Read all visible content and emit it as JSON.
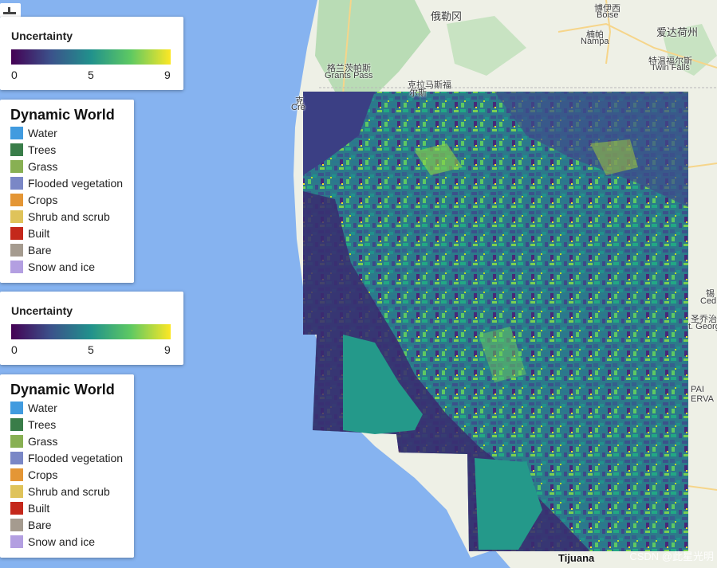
{
  "colors": {
    "ocean": "#86b3f0",
    "land": "#eef0e6",
    "forest": "#b9dcb5",
    "uncertainty_ramp": [
      "#440154",
      "#3b528b",
      "#21918c",
      "#5ec962",
      "#fde725"
    ]
  },
  "map_labels": {
    "oregon": "俄勒冈",
    "boise_cn": "博伊西",
    "boise": "Boise",
    "nampa_cn": "楠帕",
    "nampa": "Nampa",
    "idaho": "爱达荷州",
    "twin_falls_cn": "特温福尔斯",
    "twin_falls": "Twin Falls",
    "grants_pass_cn": "格兰茨帕斯",
    "grants_pass": "Grants Pass",
    "klamath_cn": "克拉马斯福",
    "klamath_partial": "尔斯",
    "crescent_cn_partial": "克",
    "crescent_partial": "Cre",
    "cedar_cn_partial": "锡",
    "cedar_partial": "Ced",
    "st_george_cn_partial": "圣乔治",
    "st_george_partial": "t. Georg",
    "kaibab_partial_1": "PAI",
    "kaibab_partial_2": "ERVA",
    "tijuana": "Tijuana"
  },
  "tool_icon": "draw-tool-icon",
  "legends": [
    {
      "type": "uncertainty",
      "title": "Uncertainty",
      "ticks": [
        "0",
        "5",
        "9"
      ]
    },
    {
      "type": "dynamic-world",
      "title": "Dynamic World",
      "items": [
        {
          "label": "Water",
          "color": "#419bdf"
        },
        {
          "label": "Trees",
          "color": "#397d49"
        },
        {
          "label": "Grass",
          "color": "#88b053"
        },
        {
          "label": "Flooded vegetation",
          "color": "#7a87c6"
        },
        {
          "label": "Crops",
          "color": "#e49635"
        },
        {
          "label": "Shrub and scrub",
          "color": "#dfc35a"
        },
        {
          "label": "Built",
          "color": "#c4281b"
        },
        {
          "label": "Bare",
          "color": "#a59b8f"
        },
        {
          "label": "Snow and ice",
          "color": "#b39fe1"
        }
      ]
    },
    {
      "type": "uncertainty",
      "title": "Uncertainty",
      "ticks": [
        "0",
        "5",
        "9"
      ]
    },
    {
      "type": "dynamic-world",
      "title": "Dynamic World",
      "items": [
        {
          "label": "Water",
          "color": "#419bdf"
        },
        {
          "label": "Trees",
          "color": "#397d49"
        },
        {
          "label": "Grass",
          "color": "#88b053"
        },
        {
          "label": "Flooded vegetation",
          "color": "#7a87c6"
        },
        {
          "label": "Crops",
          "color": "#e49635"
        },
        {
          "label": "Shrub and scrub",
          "color": "#dfc35a"
        },
        {
          "label": "Built",
          "color": "#c4281b"
        },
        {
          "label": "Bare",
          "color": "#a59b8f"
        },
        {
          "label": "Snow and ice",
          "color": "#b39fe1"
        }
      ]
    }
  ],
  "watermark": "CSDN @此星光明"
}
